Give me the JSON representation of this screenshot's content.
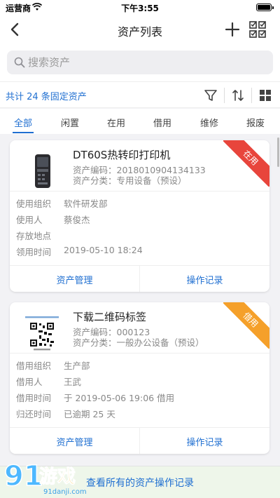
{
  "status": {
    "carrier": "运营商",
    "time": "下午3:55"
  },
  "nav": {
    "title": "资产列表"
  },
  "search": {
    "placeholder": "搜索资产"
  },
  "summary": {
    "count_text": "共计 24 条固定资产"
  },
  "tabs": [
    {
      "label": "全部",
      "active": true
    },
    {
      "label": "闲置"
    },
    {
      "label": "在用"
    },
    {
      "label": "借用"
    },
    {
      "label": "维修"
    },
    {
      "label": "报废"
    }
  ],
  "cards": [
    {
      "name": "DT60S热转印打印机",
      "code": "资产编码：2018010904134133",
      "category": "资产分类：专用设备（预设）",
      "status": "在用",
      "status_color": "#e8453c",
      "rows": [
        {
          "label": "使用组织",
          "value": "软件研发部"
        },
        {
          "label": "使用人",
          "value": "蔡俊杰"
        },
        {
          "label": "存放地点",
          "value": ""
        },
        {
          "label": "领用时间",
          "value": "2019-05-10 18:24"
        }
      ],
      "actions": [
        "资产管理",
        "操作记录"
      ]
    },
    {
      "name": "下载二维码标签",
      "code": "资产编码：000123",
      "category": "资产分类：一般办公设备（预设）",
      "status": "借用",
      "status_color": "#f5a02a",
      "rows": [
        {
          "label": "借用组织",
          "value": "生产部"
        },
        {
          "label": "借用人",
          "value": "王武"
        },
        {
          "label": "借用时间",
          "value": "于 2019-05-06 19:06 借用"
        },
        {
          "label": "归还时间",
          "value": "已逾期 25 天"
        }
      ],
      "actions": [
        "资产管理",
        "操作记录"
      ]
    }
  ],
  "bottom": {
    "text": "查看所有的资产操作记录"
  },
  "watermark": {
    "text": "91游戏",
    "sub": "91danji.com"
  },
  "colors": {
    "accent": "#1f6fd1",
    "in_use": "#e8453c",
    "borrowed": "#f5a02a"
  }
}
